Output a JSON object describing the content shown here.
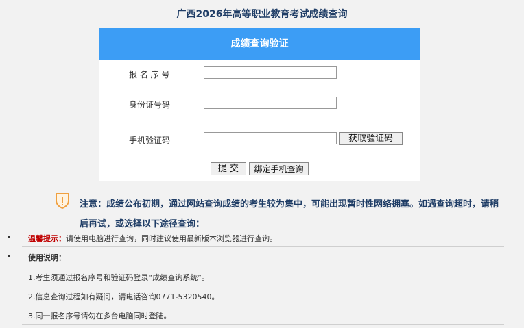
{
  "page": {
    "title": "广西2026年高等职业教育考试成绩查询"
  },
  "form": {
    "header": "成绩查询验证",
    "fields": {
      "reg_no_label": "报 名 序 号",
      "id_label": "身份证号码",
      "sms_label": "手机验证码"
    },
    "get_code_button": "获取验证码",
    "submit_button": "提 交",
    "bind_phone_button": "绑定手机查询"
  },
  "notice": {
    "icon": "warning-shield-icon",
    "text": "注意：成绩公布初期，通过网站查询成绩的考生较为集中，可能出现暂时性网络拥塞。如遇查询超时，请稍后再试，或选择以下途径查询："
  },
  "tip": {
    "label": "温馨提示：",
    "text": "请使用电脑进行查询，同时建议使用最新版本浏览器进行查询。"
  },
  "instructions": {
    "title": "使用说明：",
    "items": [
      "1.考生须通过报名序号和验证码登录“成绩查询系统”。",
      "2.信息查询过程如有疑问，请电话咨询0771-5320540。",
      "3.同一报名序号请勿在多台电脑同时登陆。"
    ]
  },
  "colors": {
    "header_bg": "#3c9df5",
    "title": "#1f3d66",
    "tip_label": "#c00000",
    "icon": "#f0a040"
  }
}
